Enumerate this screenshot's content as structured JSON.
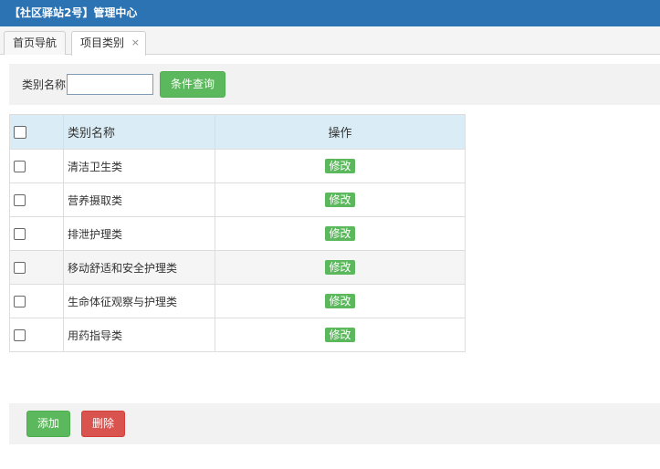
{
  "header": {
    "title": "【社区驿站2号】管理中心"
  },
  "tabs": [
    {
      "label": "首页导航"
    },
    {
      "label": "项目类别",
      "close": "×"
    }
  ],
  "search": {
    "label": "类别名称",
    "value": "",
    "placeholder": "",
    "button": "条件查询"
  },
  "table": {
    "headers": {
      "name": "类别名称",
      "op": "操作"
    },
    "rows": [
      {
        "name": "清洁卫生类",
        "action": "修改"
      },
      {
        "name": "营养摄取类",
        "action": "修改"
      },
      {
        "name": "排泄护理类",
        "action": "修改"
      },
      {
        "name": "移动舒适和安全护理类",
        "action": "修改"
      },
      {
        "name": "生命体征观察与护理类",
        "action": "修改"
      },
      {
        "name": "用药指导类",
        "action": "修改"
      }
    ]
  },
  "footer": {
    "add": "添加",
    "delete": "删除"
  },
  "colors": {
    "header_bg": "#2b73b3",
    "table_head_bg": "#daedf6",
    "green": "#5cb85c",
    "red": "#d9534f"
  }
}
